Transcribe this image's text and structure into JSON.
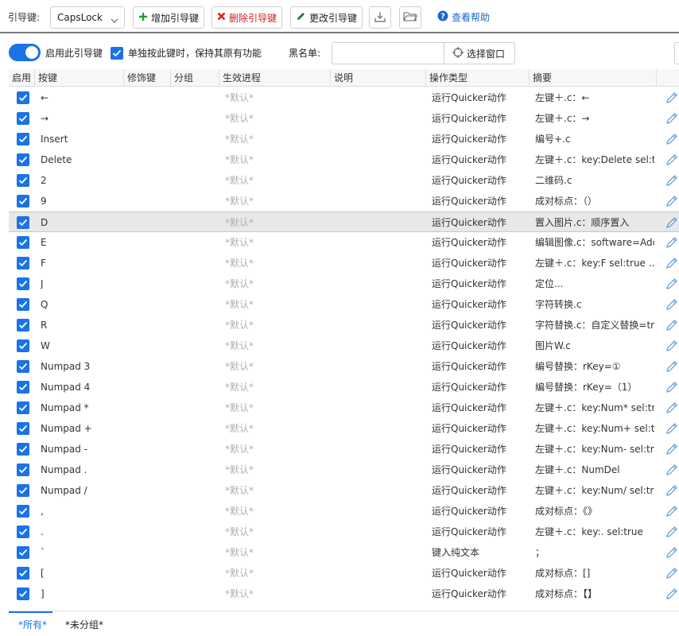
{
  "toolbar": {
    "guide_key_label": "引导键:",
    "guide_key_value": "CapsLock",
    "add_label": "增加引导键",
    "delete_label": "删除引导键",
    "change_label": "更改引导键",
    "help_label": "查看帮助"
  },
  "options": {
    "enable_label": "启用此引导键",
    "keep_label": "单独按此键时，保持其原有功能",
    "blacklist_label": "黑名单:",
    "blacklist_value": "",
    "select_window_label": "选择窗口"
  },
  "columns": [
    "启用",
    "按键",
    "修饰键",
    "分组",
    "生效进程",
    "说明",
    "操作类型",
    "摘要"
  ],
  "rows": [
    {
      "key": "←",
      "process": "*默认*",
      "type": "运行Quicker动作",
      "summary": "左键＋.c：←"
    },
    {
      "key": "→",
      "process": "*默认*",
      "type": "运行Quicker动作",
      "summary": "左键＋.c：→"
    },
    {
      "key": "Insert",
      "process": "*默认*",
      "type": "运行Quicker动作",
      "summary": "编号+.c"
    },
    {
      "key": "Delete",
      "process": "*默认*",
      "type": "运行Quicker动作",
      "summary": "左键＋.c：key:Delete sel:t..."
    },
    {
      "key": "2",
      "process": "*默认*",
      "type": "运行Quicker动作",
      "summary": "二维码.c"
    },
    {
      "key": "9",
      "process": "*默认*",
      "type": "运行Quicker动作",
      "summary": "成对标点：（）"
    },
    {
      "key": "D",
      "process": "*默认*",
      "type": "运行Quicker动作",
      "summary": "置入图片.c：顺序置入",
      "selected": true
    },
    {
      "key": "E",
      "process": "*默认*",
      "type": "运行Quicker动作",
      "summary": "编辑图像.c：software=Adc"
    },
    {
      "key": "F",
      "process": "*默认*",
      "type": "运行Quicker动作",
      "summary": "左键＋.c：key:F sel:true ..."
    },
    {
      "key": "J",
      "process": "*默认*",
      "type": "运行Quicker动作",
      "summary": "定位..."
    },
    {
      "key": "Q",
      "process": "*默认*",
      "type": "运行Quicker动作",
      "summary": "字符转换.c"
    },
    {
      "key": "R",
      "process": "*默认*",
      "type": "运行Quicker动作",
      "summary": "字符替换.c：自定义替换=tr"
    },
    {
      "key": "W",
      "process": "*默认*",
      "type": "运行Quicker动作",
      "summary": "图片W.c"
    },
    {
      "key": "Numpad 3",
      "process": "*默认*",
      "type": "运行Quicker动作",
      "summary": "编号替换：rKey=①"
    },
    {
      "key": "Numpad 4",
      "process": "*默认*",
      "type": "运行Quicker动作",
      "summary": "编号替换：rKey=（1）"
    },
    {
      "key": "Numpad *",
      "process": "*默认*",
      "type": "运行Quicker动作",
      "summary": "左键＋.c：key:Num* sel:tru"
    },
    {
      "key": "Numpad +",
      "process": "*默认*",
      "type": "运行Quicker动作",
      "summary": "左键＋.c：key:Num+ sel:tr"
    },
    {
      "key": "Numpad -",
      "process": "*默认*",
      "type": "运行Quicker动作",
      "summary": "左键＋.c：key:Num- sel:tru"
    },
    {
      "key": "Numpad .",
      "process": "*默认*",
      "type": "运行Quicker动作",
      "summary": "左键＋.c：NumDel"
    },
    {
      "key": "Numpad /",
      "process": "*默认*",
      "type": "运行Quicker动作",
      "summary": "左键＋.c：key:Num/ sel:tru"
    },
    {
      "key": ",",
      "process": "*默认*",
      "type": "运行Quicker动作",
      "summary": "成对标点：《》"
    },
    {
      "key": ".",
      "process": "*默认*",
      "type": "运行Quicker动作",
      "summary": "左键＋.c：key:. sel:true"
    },
    {
      "key": "`",
      "process": "*默认*",
      "type": "键入纯文本",
      "summary": "；"
    },
    {
      "key": "[",
      "process": "*默认*",
      "type": "运行Quicker动作",
      "summary": "成对标点：[]"
    },
    {
      "key": "]",
      "process": "*默认*",
      "type": "运行Quicker动作",
      "summary": "成对标点：【】"
    }
  ],
  "tabs": [
    "*所有*",
    "*未分组*"
  ],
  "colors": {
    "accent": "#1a73e8",
    "delete_red": "#d42020",
    "add_green": "#1e9e3a",
    "edit_green": "#1e7a2e"
  },
  "icons": [
    "chevron-down-icon",
    "plus-icon",
    "close-icon",
    "pencil-icon",
    "download-icon",
    "folder-icon",
    "help-circle-icon",
    "crosshair-icon",
    "checkmark-icon"
  ]
}
